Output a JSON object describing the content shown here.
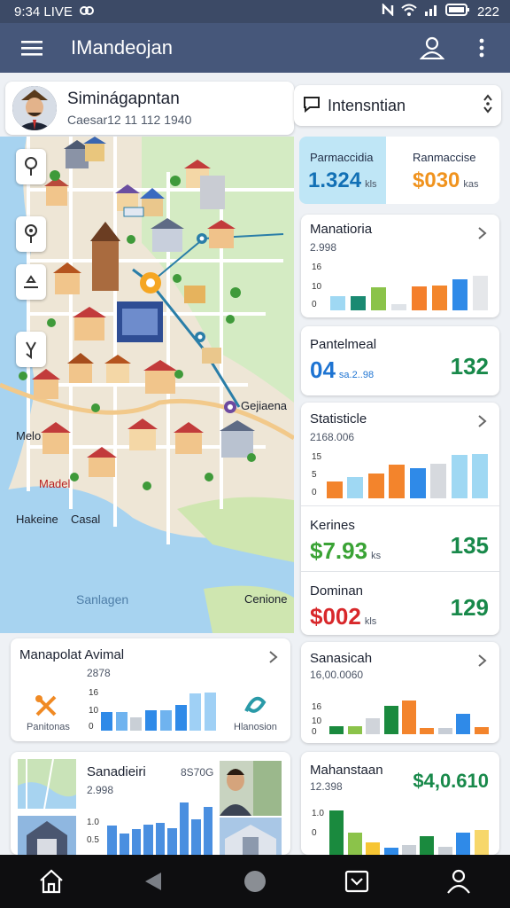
{
  "status_bar": {
    "time_left": "9:34 LIVE",
    "clock": "222"
  },
  "app_bar": {
    "title": "IMandeojan"
  },
  "profile": {
    "name": "Siminágapntan",
    "subtitle": "Caesar12 11 112 1940"
  },
  "info_chip": {
    "label": "Intensntian"
  },
  "map": {
    "labels": {
      "gejiaena": "Gejiaena",
      "mela": "Melo",
      "madel": "Madel",
      "hakeine": "Hakeine",
      "casal": "Casal",
      "sanlagen": "Sanlagen",
      "cenione": "Cenione"
    }
  },
  "metric_top": {
    "left_label": "Parmaccidia",
    "left_value": "1.324",
    "left_unit": "kls",
    "right_label": "Ranmaccise",
    "right_value": "$030",
    "right_unit": "kas"
  },
  "manatioria": {
    "title": "Manatioria",
    "sub": "2.998",
    "y_ticks": [
      "16",
      "10",
      "0"
    ],
    "bars": [
      0.28,
      0.28,
      0.46,
      0.12,
      0.48,
      0.5,
      0.62,
      0.7
    ],
    "colors": [
      "#9fd8f3",
      "#1a8a72",
      "#8bc34a",
      "#dfe3e8",
      "#f47f2c",
      "#f3862c",
      "#2f8ae8",
      "#e5e7ea"
    ]
  },
  "pantelmeal": {
    "title": "Pantelmeal",
    "value": "04",
    "unit": "sa.2..98",
    "right_value": "132",
    "value_color": "#1e74d2",
    "right_color": "#18894a"
  },
  "statistics": {
    "title": "Statisticle",
    "sub": "2168.006",
    "y_ticks": [
      "15",
      "5",
      "0"
    ],
    "bars": [
      0.36,
      0.44,
      0.52,
      0.7,
      0.63,
      0.72,
      0.9,
      0.92
    ],
    "colors": [
      "#f3842c",
      "#9fd8f3",
      "#f3842c",
      "#f3842c",
      "#2f8ae8",
      "#d6d9de",
      "#9fd8f3",
      "#9fd8f3"
    ]
  },
  "kerines": {
    "title": "Kerines",
    "value": "$7.93",
    "unit": "ks",
    "right_value": "135",
    "value_color": "#3aa335",
    "right_color": "#18894a"
  },
  "dominan": {
    "title": "Dominan",
    "value": "$002",
    "unit": "kls",
    "right_value": "129",
    "value_color": "#d8282b",
    "right_color": "#18894a"
  },
  "manapolat": {
    "title": "Manapolat Avimal",
    "sub": "2878",
    "y_ticks": [
      "16",
      "10",
      "0"
    ],
    "bars": [
      0.4,
      0.4,
      0.28,
      0.44,
      0.44,
      0.55,
      0.8,
      0.82
    ],
    "colors": [
      "#2f8ae8",
      "#6fb3ef",
      "#c9cfd6",
      "#2f8ae8",
      "#6fb3ef",
      "#2f8ae8",
      "#9fd0f5",
      "#9fd0f5"
    ],
    "left_icon_label": "Panitonas",
    "right_icon_label": "Hlanosion"
  },
  "sanasicah": {
    "title": "Sanasicah",
    "sub": "16,00.0060",
    "y_ticks": [
      "16",
      "10",
      "0"
    ],
    "bars": [
      0.18,
      0.18,
      0.34,
      0.62,
      0.74,
      0.14,
      0.14,
      0.45,
      0.15
    ],
    "colors": [
      "#1a8a3e",
      "#8bc34a",
      "#d0d4da",
      "#1a8a3e",
      "#f3842c",
      "#f3842c",
      "#c7cdd6",
      "#2f8ae8",
      "#f3842c"
    ]
  },
  "sanadieiri": {
    "title": "Sanadieiri",
    "sub": "2.998",
    "tag": "8S70G",
    "y_ticks": [
      "1.0",
      "0.5"
    ],
    "bars": [
      0.55,
      0.4,
      0.48,
      0.56,
      0.6,
      0.5,
      0.98,
      0.66,
      0.9
    ]
  },
  "mahanstaan": {
    "title": "Mahanstaan",
    "sub": "12.398",
    "value": "$4,0.610",
    "y_ticks": [
      "1.0",
      "0"
    ],
    "bars": [
      0.9,
      0.45,
      0.25,
      0.15,
      0.2,
      0.38,
      0.16,
      0.45,
      0.5
    ],
    "colors": [
      "#1a8a3e",
      "#8bc34a",
      "#f7c533",
      "#2f8ae8",
      "#c9cfd6",
      "#1a8a3e",
      "#c9cfd6",
      "#2f8ae8",
      "#f7d76a"
    ]
  }
}
